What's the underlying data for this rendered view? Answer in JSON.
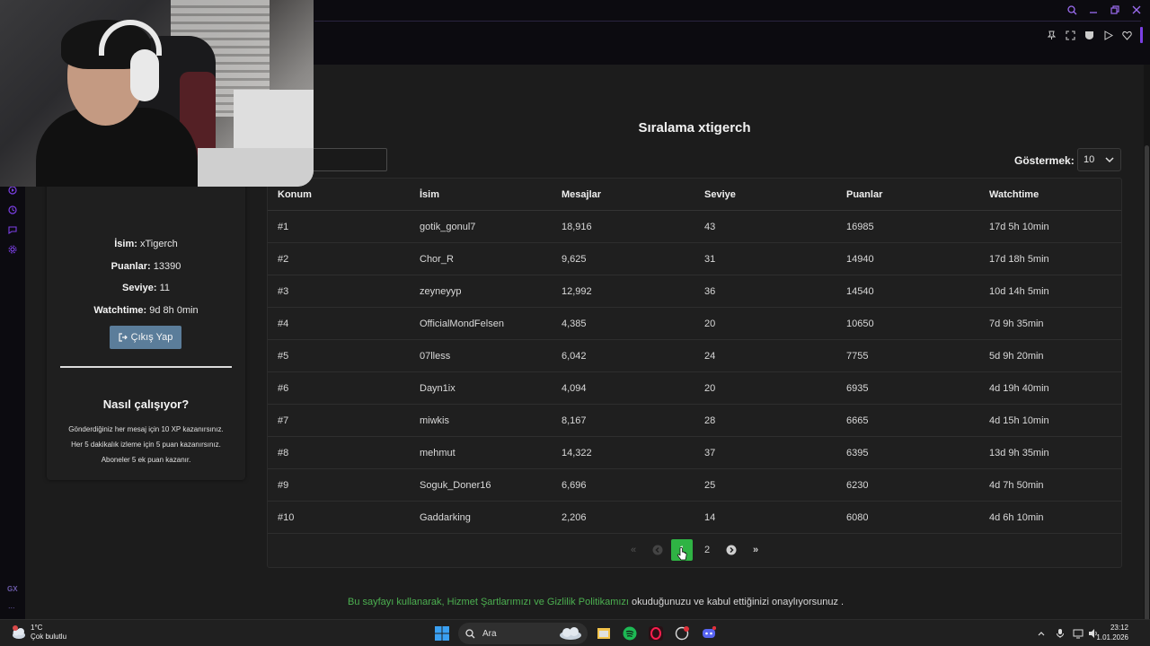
{
  "rank": {
    "title": "Sıralama xtigerch",
    "show_label": "Göstermek:",
    "show_value": "10"
  },
  "table": {
    "headers": [
      "Konum",
      "İsim",
      "Mesajlar",
      "Seviye",
      "Puanlar",
      "Watchtime"
    ],
    "rows": [
      [
        "#1",
        "gotik_gonul7",
        "18,916",
        "43",
        "16985",
        "17d 5h 10min"
      ],
      [
        "#2",
        "Chor_R",
        "9,625",
        "31",
        "14940",
        "17d 18h 5min"
      ],
      [
        "#3",
        "zeyneyyp",
        "12,992",
        "36",
        "14540",
        "10d 14h 5min"
      ],
      [
        "#4",
        "OfficialMondFelsen",
        "4,385",
        "20",
        "10650",
        "7d 9h 35min"
      ],
      [
        "#5",
        "07lless",
        "6,042",
        "24",
        "7755",
        "5d 9h 20min"
      ],
      [
        "#6",
        "Dayn1ix",
        "4,094",
        "20",
        "6935",
        "4d 19h 40min"
      ],
      [
        "#7",
        "miwkis",
        "8,167",
        "28",
        "6665",
        "4d 15h 10min"
      ],
      [
        "#8",
        "mehmut",
        "14,322",
        "37",
        "6395",
        "13d 9h 35min"
      ],
      [
        "#9",
        "Soguk_Doner16",
        "6,696",
        "25",
        "6230",
        "4d 7h 50min"
      ],
      [
        "#10",
        "Gaddarking",
        "2,206",
        "14",
        "6080",
        "4d 6h 10min"
      ]
    ]
  },
  "pagination": {
    "first": "«",
    "prev": "‹",
    "current": "1",
    "next_page": "2",
    "next": "›",
    "last": "»"
  },
  "profile": {
    "name_label": "İsim:",
    "name_value": " xTigerch",
    "points_label": "Puanlar:",
    "points_value": " 13390",
    "level_label": "Seviye:",
    "level_value": " 11",
    "watch_label": "Watchtime:",
    "watch_value": " 9d 8h 0min",
    "logout_label": "Çıkış Yap"
  },
  "how": {
    "title": "Nasıl çalışıyor?",
    "line1": "Gönderdiğiniz her mesaj için 10 XP kazanırsınız.",
    "line2": "Her 5 dakikalık izleme için 5 puan kazanırsınız.",
    "line3": "Aboneler 5 ek puan kazanır."
  },
  "footer": {
    "prefix": "Bu sayfayı kullanarak, Hizmet Şartlarımızı ve Gizlilik Politikamızı",
    "suffix": " okuduğunuzu ve kabul ettiğinizi onaylıyorsunuz ."
  },
  "sidebar": {
    "gx": "GX",
    "more": "..."
  },
  "taskbar": {
    "weather_temp": "1°C",
    "weather_desc": "Çok bulutlu",
    "search_placeholder": "Ara",
    "time": "23:12",
    "date": "1.01.2026"
  },
  "colors": {
    "accent_green": "#2fb344",
    "link_green": "#4caf50",
    "button_blue": "#5b7d9a",
    "opera_purple": "#7b3fe4"
  }
}
